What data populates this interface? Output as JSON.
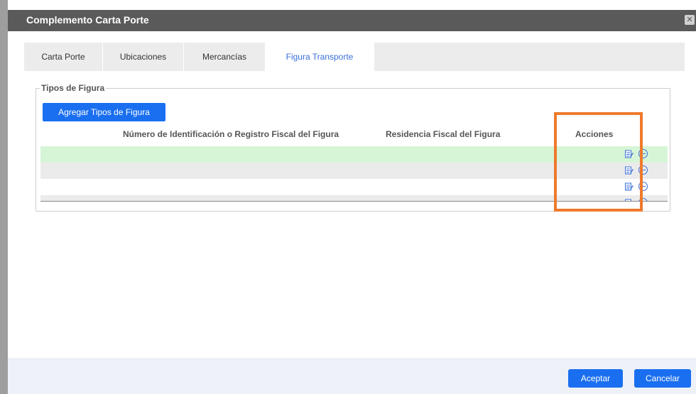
{
  "dialog": {
    "title": "Complemento Carta Porte",
    "close_icon": "close-icon"
  },
  "tabs": [
    {
      "label": "Carta Porte",
      "active": false
    },
    {
      "label": "Ubicaciones",
      "active": false
    },
    {
      "label": "Mercancías",
      "active": false
    },
    {
      "label": "Figura Transporte",
      "active": true
    }
  ],
  "section": {
    "legend": "Tipos de Figura",
    "add_button": "Agregar Tipos de Figura"
  },
  "table": {
    "columns": [
      "Número de Identificación o Registro Fiscal del Figura",
      "Residencia Fiscal del Figura",
      "Acciones"
    ],
    "rows": [
      {
        "registro_fiscal": "",
        "residencia_fiscal": "",
        "actions": [
          "edit-icon",
          "remove-icon"
        ],
        "selected": true
      },
      {
        "registro_fiscal": "",
        "residencia_fiscal": "",
        "actions": [
          "edit-icon",
          "remove-icon"
        ],
        "selected": false
      },
      {
        "registro_fiscal": "",
        "residencia_fiscal": "",
        "actions": [
          "edit-icon",
          "remove-icon"
        ],
        "selected": false
      },
      {
        "registro_fiscal": "",
        "residencia_fiscal": "",
        "actions": [
          "edit-icon",
          "remove-icon"
        ],
        "selected": false
      }
    ]
  },
  "footer": {
    "accept_label": "Aceptar",
    "cancel_label": "Cancelar"
  },
  "colors": {
    "titlebar": "#5a5a5a",
    "primary_button": "#1a6ff0",
    "selected_row": "#d6f5d6",
    "alt_row": "#ebebeb",
    "highlight_box": "#ee7a2d",
    "active_tab_text": "#3a6fd8"
  }
}
